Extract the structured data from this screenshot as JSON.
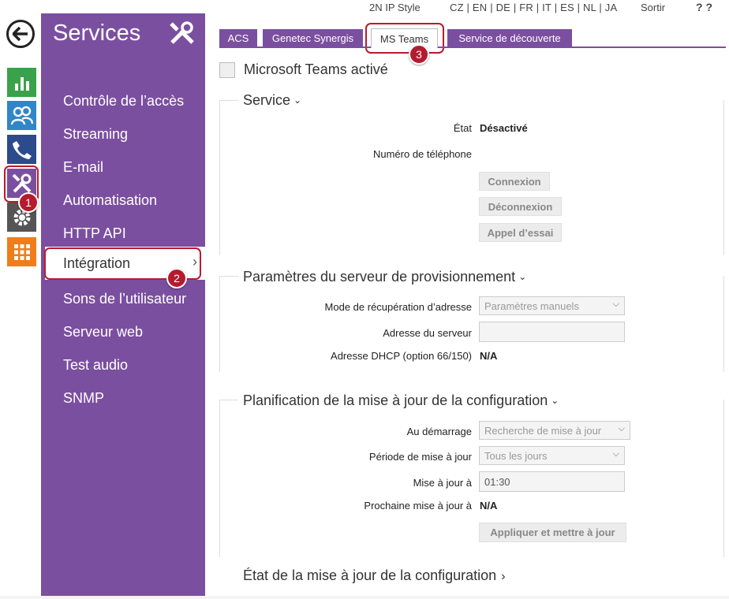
{
  "topbar": {
    "style_link": "2N IP Style",
    "languages": "CZ | EN | DE | FR | IT | ES | NL | JA",
    "logout": "Sortir",
    "help": "? ?"
  },
  "sidebar": {
    "title": "Services",
    "items": [
      {
        "label": "Contrôle de l’accès"
      },
      {
        "label": "Streaming"
      },
      {
        "label": "E-mail"
      },
      {
        "label": "Automatisation"
      },
      {
        "label": "HTTP API"
      },
      {
        "label": "Intégration"
      },
      {
        "label": "Sons de l’utilisateur"
      },
      {
        "label": "Serveur web"
      },
      {
        "label": "Test audio"
      },
      {
        "label": "SNMP"
      }
    ],
    "active_chevron": "›"
  },
  "badges": {
    "one": "1",
    "two": "2",
    "three": "3"
  },
  "tabs": [
    {
      "label": "ACS"
    },
    {
      "label": "Genetec Synergis"
    },
    {
      "label": "MS Teams"
    },
    {
      "label": "Service de découverte"
    }
  ],
  "enable_checkbox": {
    "label": "Microsoft Teams activé"
  },
  "service": {
    "title": "Service",
    "state_label": "État",
    "state_value": "Désactivé",
    "phone_label": "Numéro de téléphone",
    "connect_button": "Connexion",
    "disconnect_button": "Déconnexion",
    "test_call_button": "Appel d’essai"
  },
  "provisioning": {
    "title": "Paramètres du serveur de provisionnement",
    "mode_label": "Mode de récupération d’adresse",
    "mode_value": "Paramètres manuels",
    "server_label": "Adresse du serveur",
    "server_value": "",
    "dhcp_label": "Adresse DHCP (option 66/150)",
    "dhcp_value": "N/A"
  },
  "schedule": {
    "title": "Planification de la mise à jour de la configuration",
    "startup_label": "Au démarrage",
    "startup_value": "Recherche de mise à jour",
    "period_label": "Période de mise à jour",
    "period_value": "Tous les jours",
    "time_label": "Mise à jour à",
    "time_value": "01:30",
    "next_label": "Prochaine mise à jour à",
    "next_value": "N/A",
    "apply_button": "Appliquer et mettre à jour"
  },
  "config_state": {
    "title": "État de la mise à jour de la configuration"
  },
  "caret_down": "⌄",
  "caret_right": "›",
  "select_arrow": "⌵",
  "colors": {
    "purple": "#7b4fa0",
    "annotation_red": "#b51b2e",
    "green": "#3aa24a",
    "blue": "#2f86c8",
    "navy": "#2c4a8c",
    "orange": "#ef7d1a"
  },
  "icons": [
    "back-arrow-icon",
    "bar-chart-icon",
    "users-icon",
    "phone-icon",
    "tools-icon",
    "gear-icon",
    "grid-icon"
  ]
}
